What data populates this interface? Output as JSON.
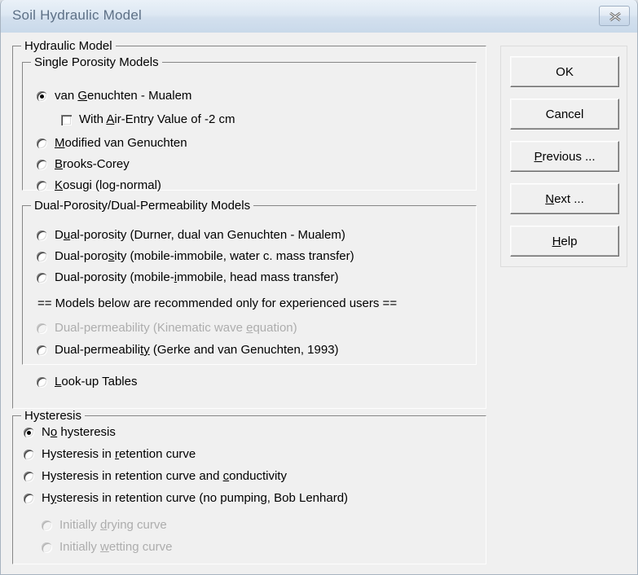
{
  "window": {
    "title": "Soil Hydraulic Model",
    "close_label": "Close",
    "bg_color": "#f0f0f0",
    "titlebar_color": "#dde8f3",
    "disabled_text_color": "#adadad"
  },
  "hydraulic_model": {
    "legend": "Hydraulic Model",
    "single_porosity": {
      "legend": "Single Porosity Models",
      "options": [
        {
          "label": "van Genuchten - Mualem",
          "accel": "G",
          "selected": true,
          "enabled": true
        },
        {
          "label": "Modified van Genuchten",
          "accel": "M",
          "selected": false,
          "enabled": true
        },
        {
          "label": "Brooks-Corey",
          "accel": "B",
          "selected": false,
          "enabled": true
        },
        {
          "label": "Kosugi (log-normal)",
          "accel": "K",
          "selected": false,
          "enabled": true
        }
      ],
      "air_entry_checkbox": {
        "label": "With Air-Entry Value of -2 cm",
        "accel": "A",
        "checked": false,
        "enabled": true
      }
    },
    "dual_porosity": {
      "legend": "Dual-Porosity/Dual-Permeability Models",
      "options": [
        {
          "label": "Dual-porosity (Durner, dual van Genuchten - Mualem)",
          "accel": "u",
          "selected": false,
          "enabled": true
        },
        {
          "label": "Dual-porosity (mobile-immobile, water c. mass transfer)",
          "accel": "s",
          "selected": false,
          "enabled": true
        },
        {
          "label": "Dual-porosity (mobile-immobile, head mass transfer)",
          "accel": "i",
          "selected": false,
          "enabled": true
        }
      ],
      "note": "== Models below are recommended only for experienced users ==",
      "advanced_options": [
        {
          "label": "Dual-permeability (Kinematic wave equation)",
          "accel": "e",
          "selected": false,
          "enabled": false
        },
        {
          "label": "Dual-permeability (Gerke and van Genuchten, 1993)",
          "accel": "ty",
          "selected": false,
          "enabled": true
        }
      ]
    },
    "lookup_tables": {
      "label": "Look-up Tables",
      "accel": "L",
      "selected": false,
      "enabled": true
    }
  },
  "hysteresis": {
    "legend": "Hysteresis",
    "options": [
      {
        "label": "No hysteresis",
        "accel": "o",
        "selected": true,
        "enabled": true
      },
      {
        "label": "Hysteresis in retention curve",
        "accel": "r",
        "selected": false,
        "enabled": true
      },
      {
        "label": "Hysteresis in retention curve and conductivity",
        "accel": "c",
        "selected": false,
        "enabled": true
      },
      {
        "label": "Hysteresis in retention curve (no pumping, Bob Lenhard)",
        "accel": "y",
        "selected": false,
        "enabled": true
      }
    ],
    "sub_options": [
      {
        "label": "Initially drying curve",
        "accel": "d",
        "selected": false,
        "enabled": false
      },
      {
        "label": "Initially wetting curve",
        "accel": "w",
        "selected": false,
        "enabled": false
      }
    ]
  },
  "buttons": [
    {
      "label": "OK",
      "accel": ""
    },
    {
      "label": "Cancel",
      "accel": ""
    },
    {
      "label": "Previous ...",
      "accel": "P"
    },
    {
      "label": "Next ...",
      "accel": "N"
    },
    {
      "label": "Help",
      "accel": "H"
    }
  ]
}
